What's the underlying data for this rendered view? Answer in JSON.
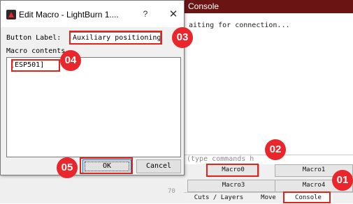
{
  "console": {
    "title": "Console",
    "output": "aiting for connection...",
    "input_placeholder": "(type commands h",
    "macros": [
      "Macro0",
      "Macro1",
      "Macro3",
      "Macro4"
    ],
    "tabs": [
      "Cuts / Layers",
      "Move",
      "Console"
    ],
    "ruler_value": "70"
  },
  "dialog": {
    "title": "Edit Macro - LightBurn 1....",
    "help_symbol": "?",
    "close_symbol": "✕",
    "button_label_caption": "Button Label:",
    "button_label_value": "Auxiliary positioning",
    "macro_contents_caption": "Macro contents",
    "macro_contents_value": "[ESP501]",
    "ok_label": "OK",
    "cancel_label": "Cancel"
  },
  "annotations": {
    "badges": [
      "01",
      "02",
      "03",
      "04",
      "05"
    ],
    "color": "#e8262b"
  },
  "icons": {
    "app_icon": "lightburn-app-icon"
  }
}
